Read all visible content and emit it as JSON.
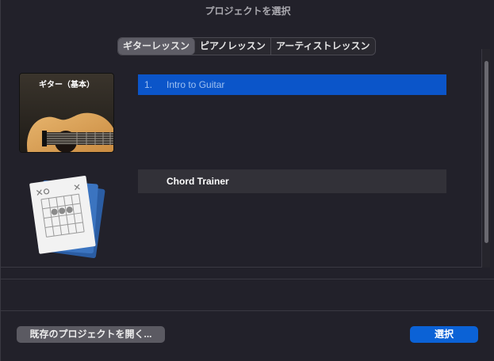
{
  "window": {
    "title": "プロジェクトを選択"
  },
  "tabs": [
    {
      "label": "ギターレッスン",
      "active": true
    },
    {
      "label": "ピアノレッスン",
      "active": false
    },
    {
      "label": "アーティストレッスン",
      "active": false
    }
  ],
  "lessons": [
    {
      "card_title": "ギター（基本）",
      "number": "1.",
      "title": "Intro to Guitar",
      "selected": true
    },
    {
      "card_title": "",
      "number": "",
      "title": "Chord Trainer",
      "selected": false
    }
  ],
  "buttons": {
    "open_existing": "既存のプロジェクトを開く...",
    "select": "選択"
  },
  "colors": {
    "selection": "#0b55c9",
    "primary_button": "#0b62d6",
    "background": "#22212a"
  }
}
